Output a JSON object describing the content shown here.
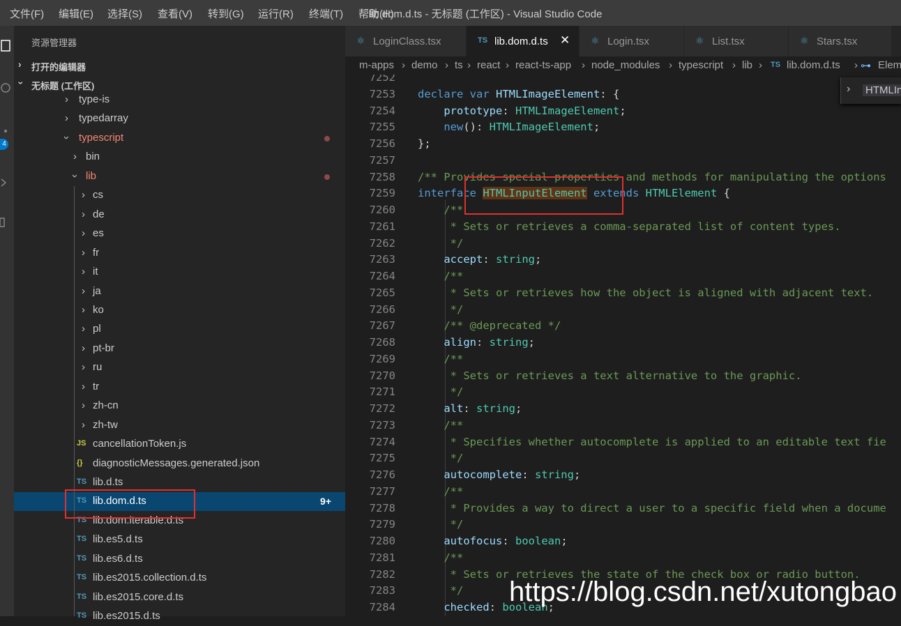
{
  "menu": [
    "文件(F)",
    "编辑(E)",
    "选择(S)",
    "查看(V)",
    "转到(G)",
    "运行(R)",
    "终端(T)",
    "帮助(H)"
  ],
  "window_title": "lib.dom.d.ts - 无标题 (工作区) - Visual Studio Code",
  "activity_badge": "4",
  "explorer": {
    "title": "资源管理器",
    "open_editors": "打开的编辑器",
    "workspace": "无标题 (工作区)"
  },
  "tree": [
    {
      "name": "type-is",
      "kind": "folder",
      "depth": 0
    },
    {
      "name": "typedarray",
      "kind": "folder",
      "depth": 0
    },
    {
      "name": "typescript",
      "kind": "folder-open",
      "depth": 0,
      "modified": true
    },
    {
      "name": "bin",
      "kind": "folder",
      "depth": 1
    },
    {
      "name": "lib",
      "kind": "folder-open",
      "depth": 1,
      "modified": true
    },
    {
      "name": "cs",
      "kind": "folder",
      "depth": 2
    },
    {
      "name": "de",
      "kind": "folder",
      "depth": 2
    },
    {
      "name": "es",
      "kind": "folder",
      "depth": 2
    },
    {
      "name": "fr",
      "kind": "folder",
      "depth": 2
    },
    {
      "name": "it",
      "kind": "folder",
      "depth": 2
    },
    {
      "name": "ja",
      "kind": "folder",
      "depth": 2
    },
    {
      "name": "ko",
      "kind": "folder",
      "depth": 2
    },
    {
      "name": "pl",
      "kind": "folder",
      "depth": 2
    },
    {
      "name": "pt-br",
      "kind": "folder",
      "depth": 2
    },
    {
      "name": "ru",
      "kind": "folder",
      "depth": 2
    },
    {
      "name": "tr",
      "kind": "folder",
      "depth": 2
    },
    {
      "name": "zh-cn",
      "kind": "folder",
      "depth": 2
    },
    {
      "name": "zh-tw",
      "kind": "folder",
      "depth": 2
    },
    {
      "name": "cancellationToken.js",
      "kind": "js",
      "icon": "JS",
      "depth": 2
    },
    {
      "name": "diagnosticMessages.generated.json",
      "kind": "json",
      "icon": "{}",
      "depth": 2
    },
    {
      "name": "lib.d.ts",
      "kind": "ts",
      "icon": "TS",
      "depth": 2
    },
    {
      "name": "lib.dom.d.ts",
      "kind": "ts",
      "icon": "TS",
      "depth": 2,
      "selected": true,
      "badge": "9+"
    },
    {
      "name": "lib.dom.iterable.d.ts",
      "kind": "ts",
      "icon": "TS",
      "depth": 2
    },
    {
      "name": "lib.es5.d.ts",
      "kind": "ts",
      "icon": "TS",
      "depth": 2
    },
    {
      "name": "lib.es6.d.ts",
      "kind": "ts",
      "icon": "TS",
      "depth": 2
    },
    {
      "name": "lib.es2015.collection.d.ts",
      "kind": "ts",
      "icon": "TS",
      "depth": 2
    },
    {
      "name": "lib.es2015.core.d.ts",
      "kind": "ts",
      "icon": "TS",
      "depth": 2
    },
    {
      "name": "lib.es2015.d.ts",
      "kind": "ts",
      "icon": "TS",
      "depth": 2
    }
  ],
  "tabs": [
    {
      "label": "LoginClass.tsx",
      "icon": "react-icon"
    },
    {
      "label": "lib.dom.d.ts",
      "icon": "TS",
      "active": true,
      "close": "✕"
    },
    {
      "label": "Login.tsx",
      "icon": "react-icon"
    },
    {
      "label": "List.tsx",
      "icon": "react-icon"
    },
    {
      "label": "Stars.tsx",
      "icon": "react-icon"
    }
  ],
  "breadcrumb": [
    "m-apps",
    "demo",
    "ts",
    "react",
    "react-ts-app",
    "node_modules",
    "typescript",
    "lib",
    "lib.dom.d.ts",
    "Elem"
  ],
  "breadcrumb_file_icon": "TS",
  "peek_label": "HTMLIn",
  "code_lines": [
    {
      "n": "7252",
      "tokens": []
    },
    {
      "n": "7253",
      "tokens": [
        [
          "kw",
          "declare "
        ],
        [
          "kw",
          "var "
        ],
        [
          "pr",
          "HTMLImageElement"
        ],
        [
          "pn",
          ": {"
        ]
      ]
    },
    {
      "n": "7254",
      "tokens": [
        [
          "pn",
          "    "
        ],
        [
          "pr",
          "prototype"
        ],
        [
          "pn",
          ": "
        ],
        [
          "ty",
          "HTMLImageElement"
        ],
        [
          "pn",
          ";"
        ]
      ]
    },
    {
      "n": "7255",
      "tokens": [
        [
          "pn",
          "    "
        ],
        [
          "kw",
          "new"
        ],
        [
          "pn",
          "(): "
        ],
        [
          "ty",
          "HTMLImageElement"
        ],
        [
          "pn",
          ";"
        ]
      ]
    },
    {
      "n": "7256",
      "tokens": [
        [
          "pn",
          "};"
        ]
      ]
    },
    {
      "n": "7257",
      "tokens": []
    },
    {
      "n": "7258",
      "tokens": [
        [
          "cm",
          "/** Provides special properties and methods for manipulating the options"
        ]
      ]
    },
    {
      "n": "7259",
      "tokens": [
        [
          "kw",
          "interface "
        ],
        [
          "tyhl",
          "HTMLInputElement"
        ],
        [
          "kw",
          " extends "
        ],
        [
          "ty",
          "HTMLElement"
        ],
        [
          "pn",
          " {"
        ]
      ]
    },
    {
      "n": "7260",
      "tokens": [
        [
          "cm",
          "    /**"
        ]
      ]
    },
    {
      "n": "7261",
      "tokens": [
        [
          "cm",
          "     * Sets or retrieves a comma-separated list of content types."
        ]
      ]
    },
    {
      "n": "7262",
      "tokens": [
        [
          "cm",
          "     */"
        ]
      ]
    },
    {
      "n": "7263",
      "tokens": [
        [
          "pn",
          "    "
        ],
        [
          "pr",
          "accept"
        ],
        [
          "pn",
          ": "
        ],
        [
          "ty",
          "string"
        ],
        [
          "pn",
          ";"
        ]
      ]
    },
    {
      "n": "7264",
      "tokens": [
        [
          "cm",
          "    /**"
        ]
      ]
    },
    {
      "n": "7265",
      "tokens": [
        [
          "cm",
          "     * Sets or retrieves how the object is aligned with adjacent text."
        ]
      ]
    },
    {
      "n": "7266",
      "tokens": [
        [
          "cm",
          "     */"
        ]
      ]
    },
    {
      "n": "7267",
      "tokens": [
        [
          "cm",
          "    /** @deprecated */"
        ]
      ]
    },
    {
      "n": "7268",
      "tokens": [
        [
          "pn",
          "    "
        ],
        [
          "pr",
          "align"
        ],
        [
          "pn",
          ": "
        ],
        [
          "ty",
          "string"
        ],
        [
          "pn",
          ";"
        ]
      ]
    },
    {
      "n": "7269",
      "tokens": [
        [
          "cm",
          "    /**"
        ]
      ]
    },
    {
      "n": "7270",
      "tokens": [
        [
          "cm",
          "     * Sets or retrieves a text alternative to the graphic."
        ]
      ]
    },
    {
      "n": "7271",
      "tokens": [
        [
          "cm",
          "     */"
        ]
      ]
    },
    {
      "n": "7272",
      "tokens": [
        [
          "pn",
          "    "
        ],
        [
          "pr",
          "alt"
        ],
        [
          "pn",
          ": "
        ],
        [
          "ty",
          "string"
        ],
        [
          "pn",
          ";"
        ]
      ]
    },
    {
      "n": "7273",
      "tokens": [
        [
          "cm",
          "    /**"
        ]
      ]
    },
    {
      "n": "7274",
      "tokens": [
        [
          "cm",
          "     * Specifies whether autocomplete is applied to an editable text fie"
        ]
      ]
    },
    {
      "n": "7275",
      "tokens": [
        [
          "cm",
          "     */"
        ]
      ]
    },
    {
      "n": "7276",
      "tokens": [
        [
          "pn",
          "    "
        ],
        [
          "pr",
          "autocomplete"
        ],
        [
          "pn",
          ": "
        ],
        [
          "ty",
          "string"
        ],
        [
          "pn",
          ";"
        ]
      ]
    },
    {
      "n": "7277",
      "tokens": [
        [
          "cm",
          "    /**"
        ]
      ]
    },
    {
      "n": "7278",
      "tokens": [
        [
          "cm",
          "     * Provides a way to direct a user to a specific field when a docume"
        ]
      ]
    },
    {
      "n": "7279",
      "tokens": [
        [
          "cm",
          "     */"
        ]
      ]
    },
    {
      "n": "7280",
      "tokens": [
        [
          "pn",
          "    "
        ],
        [
          "pr",
          "autofocus"
        ],
        [
          "pn",
          ": "
        ],
        [
          "ty",
          "boolean"
        ],
        [
          "pn",
          ";"
        ]
      ]
    },
    {
      "n": "7281",
      "tokens": [
        [
          "cm",
          "    /**"
        ]
      ]
    },
    {
      "n": "7282",
      "tokens": [
        [
          "cm",
          "     * Sets or retrieves the state of the check box or radio button."
        ]
      ]
    },
    {
      "n": "7283",
      "tokens": [
        [
          "cm",
          "     */"
        ]
      ]
    },
    {
      "n": "7284",
      "tokens": [
        [
          "pn",
          "    "
        ],
        [
          "pr",
          "checked"
        ],
        [
          "pn",
          ": "
        ],
        [
          "ty",
          "boolean"
        ],
        [
          "pn",
          ";"
        ]
      ]
    }
  ],
  "watermark": "https://blog.csdn.net/xutongbao",
  "colors": {
    "accent": "#094771",
    "highlight_box": "#e0302f",
    "modified": "#f48771"
  }
}
